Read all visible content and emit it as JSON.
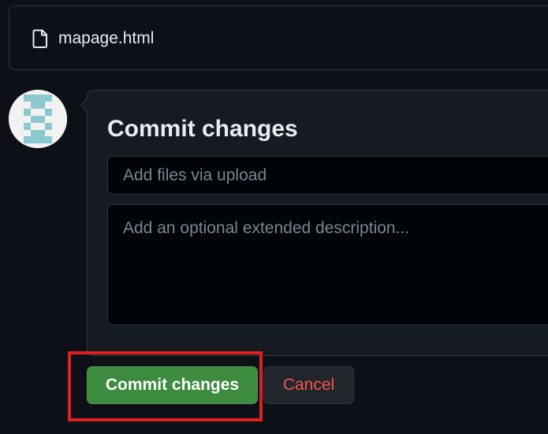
{
  "file": {
    "icon": "file-icon",
    "name": "mapage.html"
  },
  "avatar": {
    "icon": "identicon-avatar",
    "colors": [
      "#8cc8d0",
      "#f2f2f2"
    ]
  },
  "commit": {
    "title": "Commit changes",
    "summary_placeholder": "Add files via upload",
    "description_placeholder": "Add an optional extended description..."
  },
  "actions": {
    "commit_label": "Commit changes",
    "cancel_label": "Cancel",
    "commit_color": "#3c8b3f",
    "cancel_color": "#f85149",
    "highlight_color": "#e02020"
  }
}
